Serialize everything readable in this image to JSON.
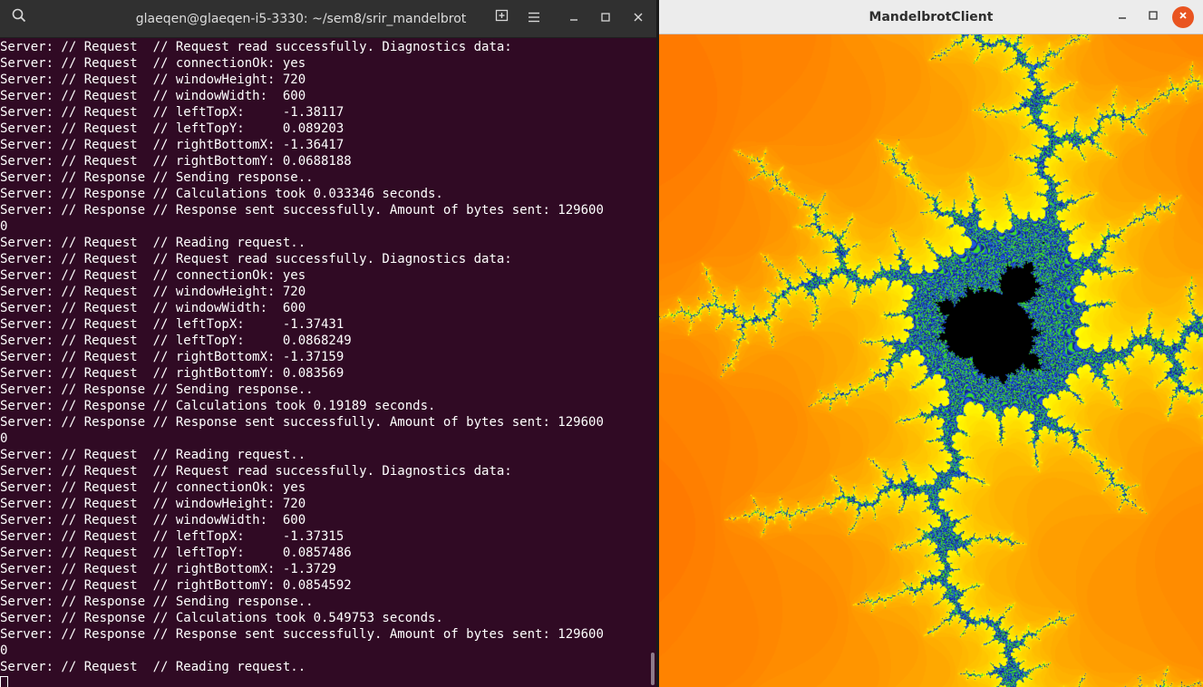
{
  "terminal": {
    "title": "glaeqen@glaeqen-i5-3330: ~/sem8/srir_mandelbrot",
    "lines": [
      "Server: // Request  // Request read successfully. Diagnostics data:",
      "Server: // Request  // connectionOk: yes",
      "Server: // Request  // windowHeight: 720",
      "Server: // Request  // windowWidth:  600",
      "Server: // Request  // leftTopX:     -1.38117",
      "Server: // Request  // leftTopY:     0.089203",
      "Server: // Request  // rightBottomX: -1.36417",
      "Server: // Request  // rightBottomY: 0.0688188",
      "Server: // Response // Sending response..",
      "Server: // Response // Calculations took 0.033346 seconds.",
      "Server: // Response // Response sent successfully. Amount of bytes sent: 129600",
      "0",
      "Server: // Request  // Reading request..",
      "Server: // Request  // Request read successfully. Diagnostics data:",
      "Server: // Request  // connectionOk: yes",
      "Server: // Request  // windowHeight: 720",
      "Server: // Request  // windowWidth:  600",
      "Server: // Request  // leftTopX:     -1.37431",
      "Server: // Request  // leftTopY:     0.0868249",
      "Server: // Request  // rightBottomX: -1.37159",
      "Server: // Request  // rightBottomY: 0.083569",
      "Server: // Response // Sending response..",
      "Server: // Response // Calculations took 0.19189 seconds.",
      "Server: // Response // Response sent successfully. Amount of bytes sent: 129600",
      "0",
      "Server: // Request  // Reading request..",
      "Server: // Request  // Request read successfully. Diagnostics data:",
      "Server: // Request  // connectionOk: yes",
      "Server: // Request  // windowHeight: 720",
      "Server: // Request  // windowWidth:  600",
      "Server: // Request  // leftTopX:     -1.37315",
      "Server: // Request  // leftTopY:     0.0857486",
      "Server: // Request  // rightBottomX: -1.3729",
      "Server: // Request  // rightBottomY: 0.0854592",
      "Server: // Response // Sending response..",
      "Server: // Response // Calculations took 0.549753 seconds.",
      "Server: // Response // Response sent successfully. Amount of bytes sent: 129600",
      "0",
      "Server: // Request  // Reading request.."
    ],
    "icons": {
      "search": "search-icon",
      "new_tab": "new-tab-icon",
      "menu": "hamburger-menu-icon",
      "minimize": "minimize-icon",
      "maximize": "maximize-icon",
      "close": "close-icon"
    },
    "colors": {
      "background": "#300a24",
      "text": "#ffffff",
      "header": "#303030"
    }
  },
  "mandelbrot_window": {
    "title": "MandelbrotClient",
    "icons": {
      "minimize": "minimize-icon",
      "maximize": "maximize-icon",
      "close": "close-icon"
    },
    "colors": {
      "close_button": "#e95420",
      "header": "#ececec"
    }
  }
}
